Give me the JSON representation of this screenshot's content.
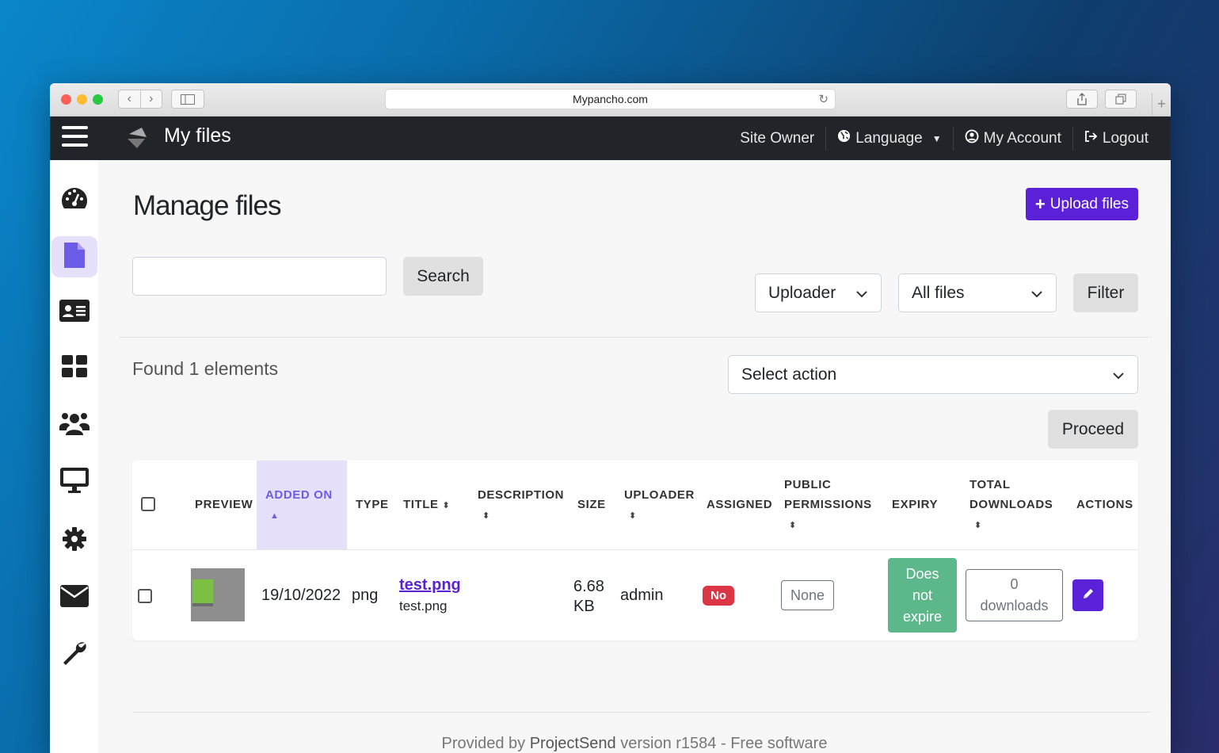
{
  "browser": {
    "url": "Mypancho.com"
  },
  "topnav": {
    "brand": "My files",
    "site_owner": "Site Owner",
    "language": "Language",
    "my_account": "My Account",
    "logout": "Logout"
  },
  "sidebar": {
    "items": [
      {
        "icon": "dashboard-icon"
      },
      {
        "icon": "file-icon",
        "active": true
      },
      {
        "icon": "id-card-icon"
      },
      {
        "icon": "grid-icon"
      },
      {
        "icon": "users-icon"
      },
      {
        "icon": "desktop-icon"
      },
      {
        "icon": "gear-icon"
      },
      {
        "icon": "envelope-icon"
      },
      {
        "icon": "wrench-icon"
      }
    ]
  },
  "main": {
    "title": "Manage files",
    "upload_label": "Upload files",
    "search_button": "Search",
    "search_value": "",
    "uploader_select": "Uploader",
    "files_select": "All files",
    "filter_button": "Filter",
    "found_text": "Found 1 elements",
    "action_select": "Select action",
    "proceed_button": "Proceed"
  },
  "table": {
    "headers": {
      "preview": "PREVIEW",
      "added_on": "ADDED ON",
      "type": "TYPE",
      "title": "TITLE",
      "description": "DESCRIPTION",
      "size": "SIZE",
      "uploader": "UPLOADER",
      "assigned": "ASSIGNED",
      "public_1": "PUBLIC",
      "public_2": "PERMISSIONS",
      "expiry": "EXPIRY",
      "total_1": "TOTAL",
      "total_2": "DOWNLOADS",
      "actions": "ACTIONS"
    },
    "rows": [
      {
        "added_on": "19/10/2022",
        "type": "png",
        "title": "test.png",
        "filename": "test.png",
        "size_1": "6.68",
        "size_2": "KB",
        "uploader": "admin",
        "assigned": "No",
        "public": "None",
        "expiry_1": "Does",
        "expiry_2": "not",
        "expiry_3": "expire",
        "downloads_1": "0",
        "downloads_2": "downloads"
      }
    ]
  },
  "footer": {
    "prefix": "Provided by",
    "product": "ProjectSend",
    "suffix": "version r1584 - Free software"
  },
  "colors": {
    "accent": "#5b21d9",
    "danger": "#dc3545",
    "success": "#5cb88a",
    "navbar": "#212529"
  }
}
